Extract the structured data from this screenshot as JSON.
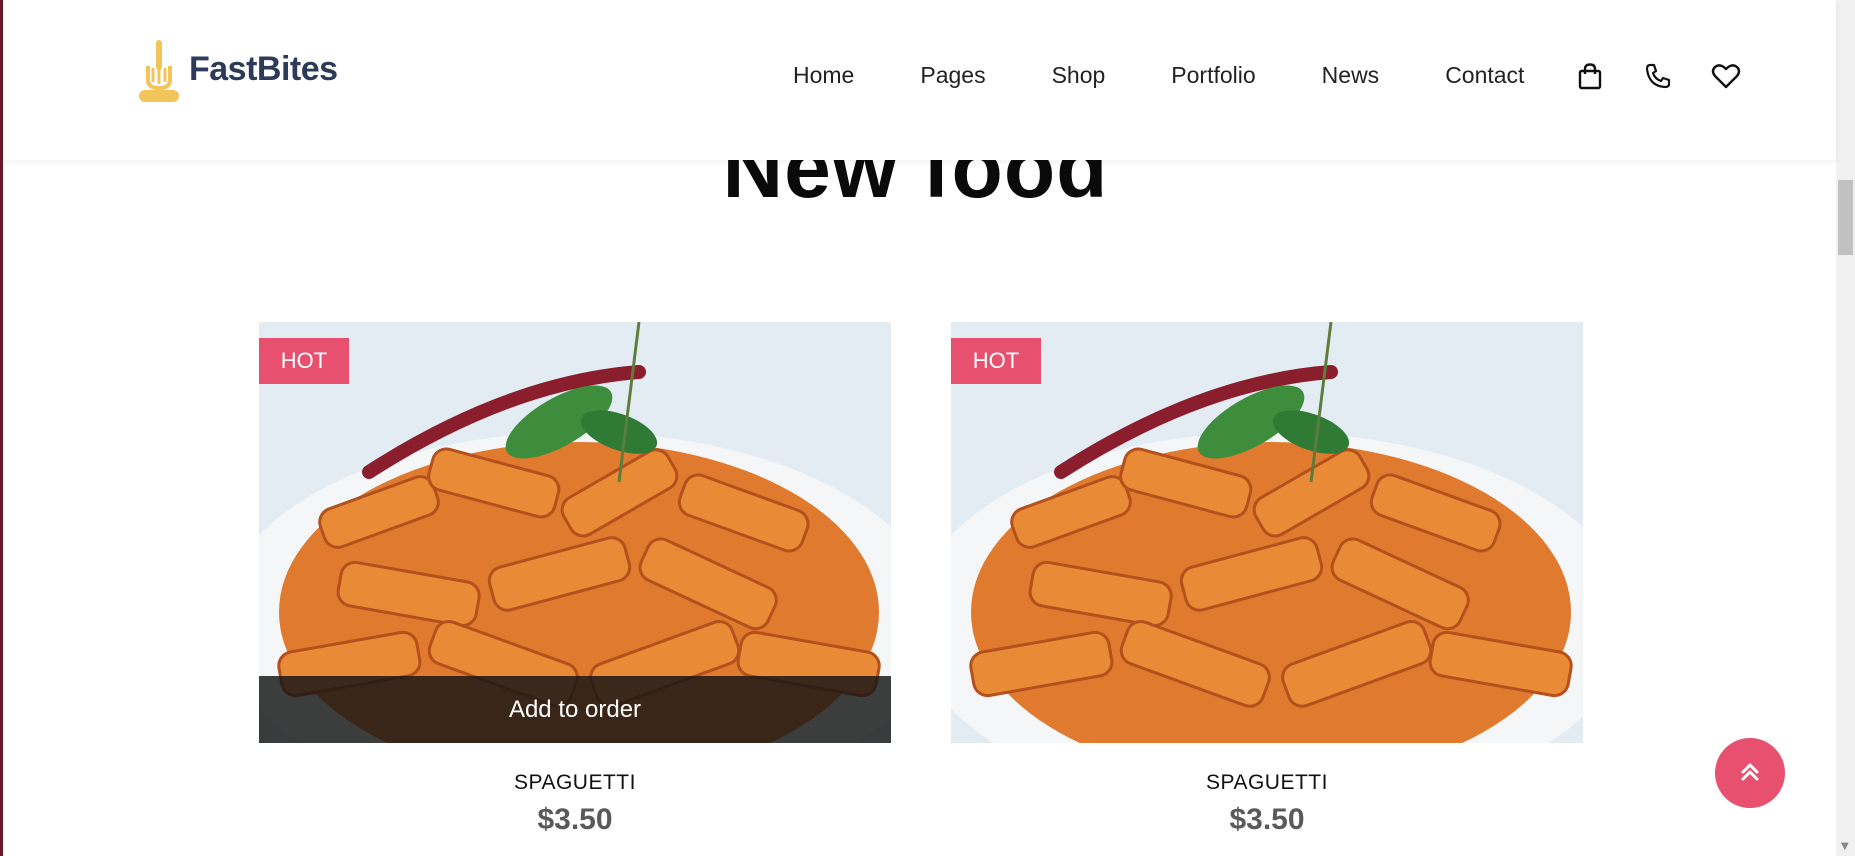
{
  "brand": {
    "name": "FastBites",
    "logo_icon": "fork-icon",
    "accent": "#f2c45a",
    "text_color": "#2e3a59"
  },
  "nav": {
    "items": [
      {
        "label": "Home"
      },
      {
        "label": "Pages"
      },
      {
        "label": "Shop"
      },
      {
        "label": "Portfolio"
      },
      {
        "label": "News"
      },
      {
        "label": "Contact"
      }
    ],
    "icons": [
      "shopping-bag-icon",
      "phone-icon",
      "heart-icon"
    ]
  },
  "section": {
    "title": "New food"
  },
  "products": [
    {
      "badge": "HOT",
      "name": "SPAGUETTI",
      "price": "$3.50",
      "action": "Add to order"
    },
    {
      "badge": "HOT",
      "name": "SPAGUETTI",
      "price": "$3.50"
    }
  ],
  "colors": {
    "badge": "#e8506f",
    "to_top_button": "#e8506f"
  },
  "back_to_top": {
    "icon": "chevrons-up-icon"
  }
}
